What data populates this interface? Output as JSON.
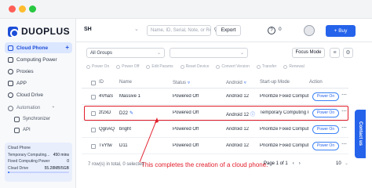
{
  "app": {
    "logo_text": "DUOPLUS"
  },
  "sidebar": {
    "items": [
      {
        "label": "Cloud Phone",
        "active": true
      },
      {
        "label": "Computing Power"
      },
      {
        "label": "Proxies"
      },
      {
        "label": "APP"
      },
      {
        "label": "Cloud Drive"
      }
    ],
    "automation": {
      "label": "Automation",
      "children": [
        "Synchronizer",
        "API"
      ]
    },
    "stats": [
      {
        "label": "Cloud Phone",
        "value": "",
        "progress": 0.1
      },
      {
        "label": "Temporary Computing...",
        "value": "450 mins",
        "progress": 0.5
      },
      {
        "label": "Fixed Computing Power",
        "value": "0",
        "progress": 0
      },
      {
        "label": "Cloud Drive",
        "value": "55.28MB/5GB",
        "progress": 0.02
      }
    ]
  },
  "topbar": {
    "team": "SH",
    "search_placeholder": "Name, ID, Serial, Note, or Remark",
    "export_label": "Export",
    "wallet_value": "0",
    "buy_label": "+ Buy"
  },
  "filters": {
    "group_select": "All Groups",
    "status_select": "",
    "focus_mode_label": "Focus Mode"
  },
  "actions": [
    "Power On",
    "Power Off",
    "Edit Params",
    "Reset Device",
    "Convert Version",
    "Transfer",
    "Renewal"
  ],
  "table": {
    "headers": {
      "id": "ID",
      "name": "Name",
      "status": "Status",
      "android": "Android",
      "startup": "Start-up Mode",
      "action": "Action"
    },
    "rows": [
      {
        "id": "4VhaS",
        "name": "Massive 1",
        "status": "Powered Off",
        "android": "Android 12",
        "startup": "Prioritize Fixed Computin...",
        "action": "Power On"
      },
      {
        "id": "zf2xD",
        "name": "D22",
        "status": "Powered Off",
        "android": "Android 12",
        "startup": "Temporary Computing Power",
        "action": "Power On"
      },
      {
        "id": "QgnAQ",
        "name": "bright",
        "status": "Powered Off",
        "android": "Android 12",
        "startup": "Prioritize Fixed Computin...",
        "action": "Power On"
      },
      {
        "id": "TvYtw",
        "name": "D11",
        "status": "Powered Off",
        "android": "Android 12",
        "startup": "Prioritize Fixed Computin...",
        "action": "Power On"
      }
    ]
  },
  "footer": {
    "selection": "7 row(s) in total, 0 selected",
    "page_label": "Page 1 of 1",
    "page_size": "10"
  },
  "annotation": "This completes the creation of a cloud phone.",
  "contact_tab": "Contact us",
  "colors": {
    "accent": "#2563eb",
    "annotation": "#e11d2a"
  }
}
